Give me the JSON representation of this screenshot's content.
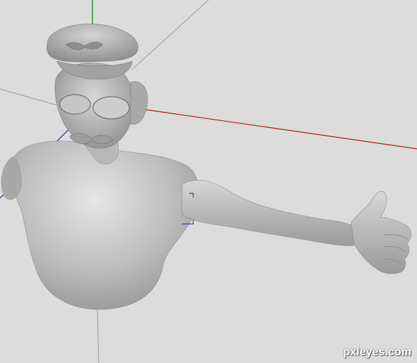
{
  "viewport": {
    "background_color": "#dcdcdc",
    "model_color": "#b9b9b9"
  },
  "axes": {
    "x_axis_color": "#b01818",
    "y_axis_color": "#1aa01a",
    "z_axis_color": "#2020a0",
    "grid_line_color": "#9a9a9a"
  },
  "watermark": {
    "text": "pxleyes.com"
  }
}
